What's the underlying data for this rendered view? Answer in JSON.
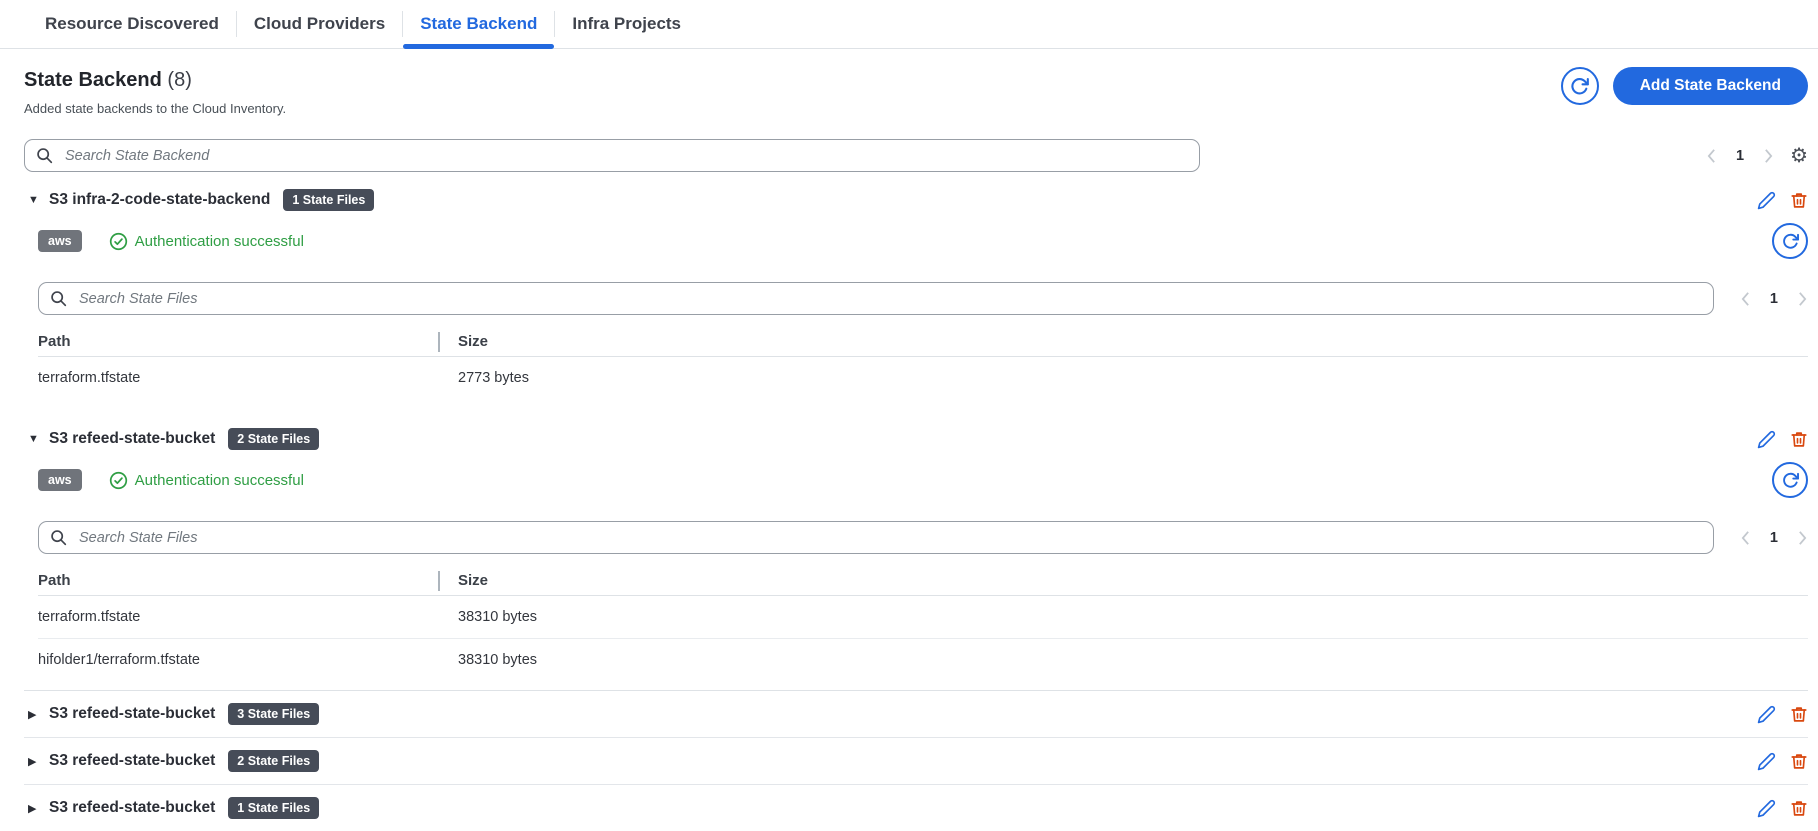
{
  "tabs": [
    {
      "label": "Resource Discovered",
      "active": false
    },
    {
      "label": "Cloud Providers",
      "active": false
    },
    {
      "label": "State Backend",
      "active": true
    },
    {
      "label": "Infra Projects",
      "active": false
    }
  ],
  "header": {
    "title": "State Backend",
    "count": "(8)",
    "subtitle": "Added state backends to the Cloud Inventory.",
    "add_button_label": "Add State Backend"
  },
  "toolbar": {
    "search_placeholder": "Search State Backend",
    "page": "1"
  },
  "table": {
    "columns": [
      "Path",
      "Size"
    ]
  },
  "backends": [
    {
      "name": "S3 infra-2-code-state-backend",
      "files_badge": "1 State Files",
      "provider": "aws",
      "status": "Authentication successful",
      "search_placeholder": "Search State Files",
      "page": "1",
      "rows": [
        {
          "path": "terraform.tfstate",
          "size": "2773 bytes"
        }
      ]
    },
    {
      "name": "S3 refeed-state-bucket",
      "files_badge": "2 State Files",
      "provider": "aws",
      "status": "Authentication successful",
      "search_placeholder": "Search State Files",
      "page": "1",
      "rows": [
        {
          "path": "terraform.tfstate",
          "size": "38310 bytes"
        },
        {
          "path": "hifolder1/terraform.tfstate",
          "size": "38310 bytes"
        }
      ]
    },
    {
      "name": "S3 refeed-state-bucket",
      "files_badge": "3 State Files"
    },
    {
      "name": "S3 refeed-state-bucket",
      "files_badge": "2 State Files"
    },
    {
      "name": "S3 refeed-state-bucket",
      "files_badge": "1 State Files"
    }
  ],
  "icons": {
    "caret_expanded": "▼",
    "caret_collapsed": "▶",
    "gear": "⚙"
  },
  "colors": {
    "accent_blue": "#2269df",
    "success_green": "#2f9e44",
    "danger_red": "#d9480f",
    "files_badge_bg": "#464c58",
    "provider_badge_bg": "#70747b"
  }
}
